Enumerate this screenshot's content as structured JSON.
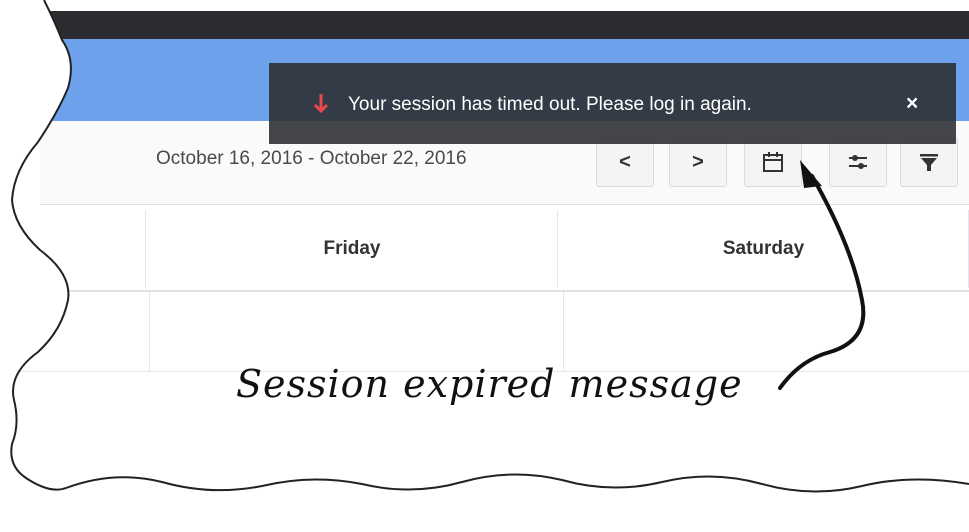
{
  "toolbar": {
    "date_range": "October 16, 2016 - October 22, 2016",
    "prev_label": "<",
    "next_label": ">",
    "icons": [
      "calendar-icon",
      "adjust-icon",
      "filter-icon"
    ]
  },
  "schedule": {
    "columns": [
      "Friday",
      "Saturday"
    ]
  },
  "notification": {
    "message": "Your session has timed out. Please log in again.",
    "close_label": "×",
    "icon": "arrow-down-icon",
    "icon_color": "#e8474c"
  },
  "annotation": {
    "text": "Session expired message"
  },
  "colors": {
    "header_blue": "#6ea1ec",
    "top_bar": "#2b2c30",
    "toast_bg": "#2b2c30"
  }
}
